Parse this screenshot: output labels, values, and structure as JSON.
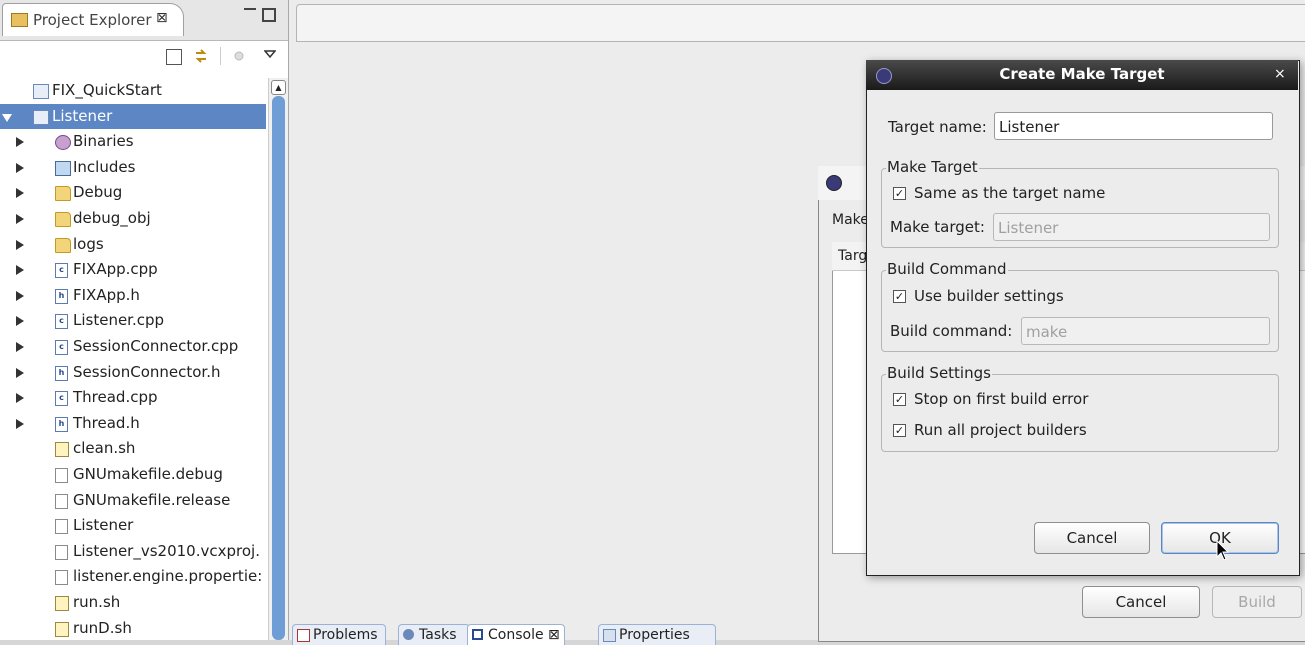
{
  "project_explorer": {
    "title": "Project Explorer",
    "tab_close": "⊠",
    "tree": [
      {
        "label": "FIX_QuickStart",
        "icon": "project-icon",
        "kind": "proj",
        "indent": 0,
        "twisty": "none"
      },
      {
        "label": "Listener",
        "icon": "project-icon",
        "kind": "proj",
        "indent": 0,
        "twisty": "open",
        "selected": true
      },
      {
        "label": "Binaries",
        "icon": "binaries-icon",
        "kind": "bin",
        "indent": 1,
        "twisty": "closed"
      },
      {
        "label": "Includes",
        "icon": "includes-icon",
        "kind": "inc",
        "indent": 1,
        "twisty": "closed"
      },
      {
        "label": "Debug",
        "icon": "folder-icon",
        "kind": "folder",
        "indent": 1,
        "twisty": "closed"
      },
      {
        "label": "debug_obj",
        "icon": "folder-icon",
        "kind": "folder",
        "indent": 1,
        "twisty": "closed"
      },
      {
        "label": "logs",
        "icon": "folder-icon",
        "kind": "folder",
        "indent": 1,
        "twisty": "closed"
      },
      {
        "label": "FIXApp.cpp",
        "icon": "cpp-file-icon",
        "kind": "cfile",
        "glyph": "c",
        "indent": 1,
        "twisty": "closed"
      },
      {
        "label": "FIXApp.h",
        "icon": "header-file-icon",
        "kind": "cfile",
        "glyph": "h",
        "indent": 1,
        "twisty": "closed"
      },
      {
        "label": "Listener.cpp",
        "icon": "cpp-file-icon",
        "kind": "cfile",
        "glyph": "c",
        "indent": 1,
        "twisty": "closed"
      },
      {
        "label": "SessionConnector.cpp",
        "icon": "cpp-file-icon",
        "kind": "cfile",
        "glyph": "c",
        "indent": 1,
        "twisty": "closed"
      },
      {
        "label": "SessionConnector.h",
        "icon": "header-file-icon",
        "kind": "cfile",
        "glyph": "h",
        "indent": 1,
        "twisty": "closed"
      },
      {
        "label": "Thread.cpp",
        "icon": "cpp-file-icon",
        "kind": "cfile",
        "glyph": "c",
        "indent": 1,
        "twisty": "closed"
      },
      {
        "label": "Thread.h",
        "icon": "header-file-icon",
        "kind": "cfile",
        "glyph": "h",
        "indent": 1,
        "twisty": "closed"
      },
      {
        "label": "clean.sh",
        "icon": "script-file-icon",
        "kind": "script",
        "indent": 1,
        "twisty": "none"
      },
      {
        "label": "GNUmakefile.debug",
        "icon": "file-icon",
        "kind": "file",
        "indent": 1,
        "twisty": "none"
      },
      {
        "label": "GNUmakefile.release",
        "icon": "file-icon",
        "kind": "file",
        "indent": 1,
        "twisty": "none"
      },
      {
        "label": "Listener",
        "icon": "file-icon",
        "kind": "file",
        "indent": 1,
        "twisty": "none"
      },
      {
        "label": "Listener_vs2010.vcxproj.",
        "icon": "file-icon",
        "kind": "file",
        "indent": 1,
        "twisty": "none"
      },
      {
        "label": "listener.engine.propertie:",
        "icon": "file-icon",
        "kind": "file",
        "indent": 1,
        "twisty": "none"
      },
      {
        "label": "run.sh",
        "icon": "script-file-icon",
        "kind": "script",
        "indent": 1,
        "twisty": "none"
      },
      {
        "label": "runD.sh",
        "icon": "script-file-icon",
        "kind": "script",
        "indent": 1,
        "twisty": "none"
      }
    ]
  },
  "bottom_tabs": [
    {
      "label": "Problems",
      "icon": "problems-icon"
    },
    {
      "label": "Tasks",
      "icon": "tasks-icon"
    },
    {
      "label": "Console ⊠",
      "icon": "console-icon"
    },
    {
      "label": "Properties",
      "icon": "properties-icon"
    }
  ],
  "back_dialog": {
    "make_label": "Make",
    "table_header": "Targ",
    "cancel_label": "Cancel",
    "build_label": "Build"
  },
  "create_make_target": {
    "title": "Create Make Target",
    "close_glyph": "×",
    "target_name_label": "Target name:",
    "target_name_value": "Listener",
    "make_target_group": "Make Target",
    "same_as_target_label": "Same as the target name",
    "same_as_target_checked": true,
    "make_target_label": "Make target:",
    "make_target_value": "Listener",
    "build_command_group": "Build Command",
    "use_builder_label": "Use builder settings",
    "use_builder_checked": true,
    "build_command_label": "Build command:",
    "build_command_value": "make",
    "build_settings_group": "Build Settings",
    "stop_on_error_label": "Stop on first build error",
    "stop_on_error_checked": true,
    "run_all_builders_label": "Run all project builders",
    "run_all_builders_checked": true,
    "cancel_label": "Cancel",
    "ok_label": "OK"
  }
}
